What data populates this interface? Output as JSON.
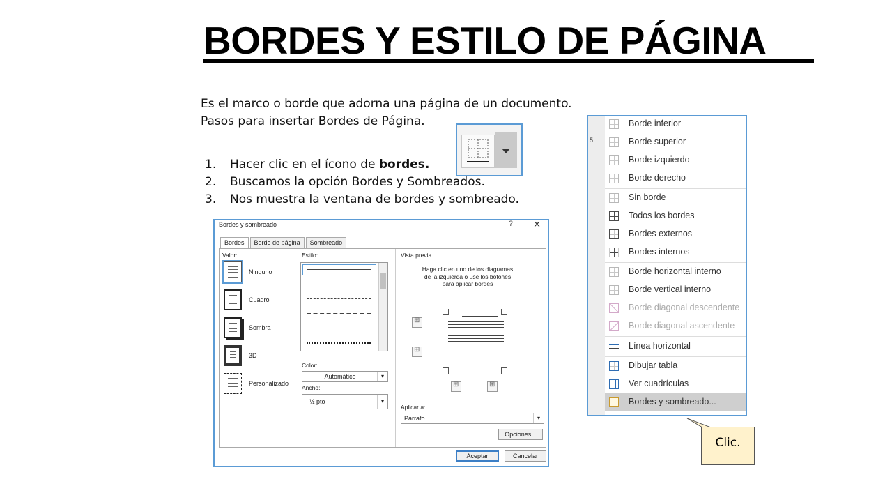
{
  "slide": {
    "title": "BORDES Y ESTILO DE PÁGINA",
    "intro_line1": "Es el marco o borde que adorna una página de un documento.",
    "intro_line2": "Pasos para insertar Bordes de Página.",
    "steps": [
      {
        "num": "1.",
        "text_a": "Hacer clic en el ícono de ",
        "text_bold": "bordes."
      },
      {
        "num": "2.",
        "text": "Buscamos la opción Bordes y Sombreados."
      },
      {
        "num": "3.",
        "text": "Nos muestra la ventana de bordes y sombreado."
      }
    ]
  },
  "dialog": {
    "title": "Bordes y sombreado",
    "help": "?",
    "close": "✕",
    "tabs": [
      "Bordes",
      "Borde de página",
      "Sombreado"
    ],
    "valor_label": "Valor:",
    "settings": [
      "Ninguno",
      "Cuadro",
      "Sombra",
      "3D",
      "Personalizado"
    ],
    "estilo_label": "Estilo:",
    "color_label": "Color:",
    "color_value": "Automático",
    "ancho_label": "Ancho:",
    "ancho_value": "½ pto",
    "vista_label": "Vista previa",
    "preview_text": "Haga clic en uno de los diagramas de la izquierda o use los botones para aplicar bordes",
    "aplicar_label": "Aplicar a:",
    "aplicar_value": "Párrafo",
    "opciones": "Opciones...",
    "aceptar": "Aceptar",
    "cancelar": "Cancelar"
  },
  "menu": {
    "side_number": "5",
    "items": [
      "Borde inferior",
      "Borde superior",
      "Borde izquierdo",
      "Borde derecho",
      "Sin borde",
      "Todos los bordes",
      "Bordes externos",
      "Bordes internos",
      "Borde horizontal interno",
      "Borde vertical interno",
      "Borde diagonal descendente",
      "Borde diagonal ascendente",
      "Línea horizontal",
      "Dibujar tabla",
      "Ver cuadrículas",
      "Bordes y sombreado..."
    ]
  },
  "callout": {
    "text": "Clic."
  },
  "colors": {
    "accent": "#5b9bd5",
    "callout_fill": "#fff2cc"
  }
}
